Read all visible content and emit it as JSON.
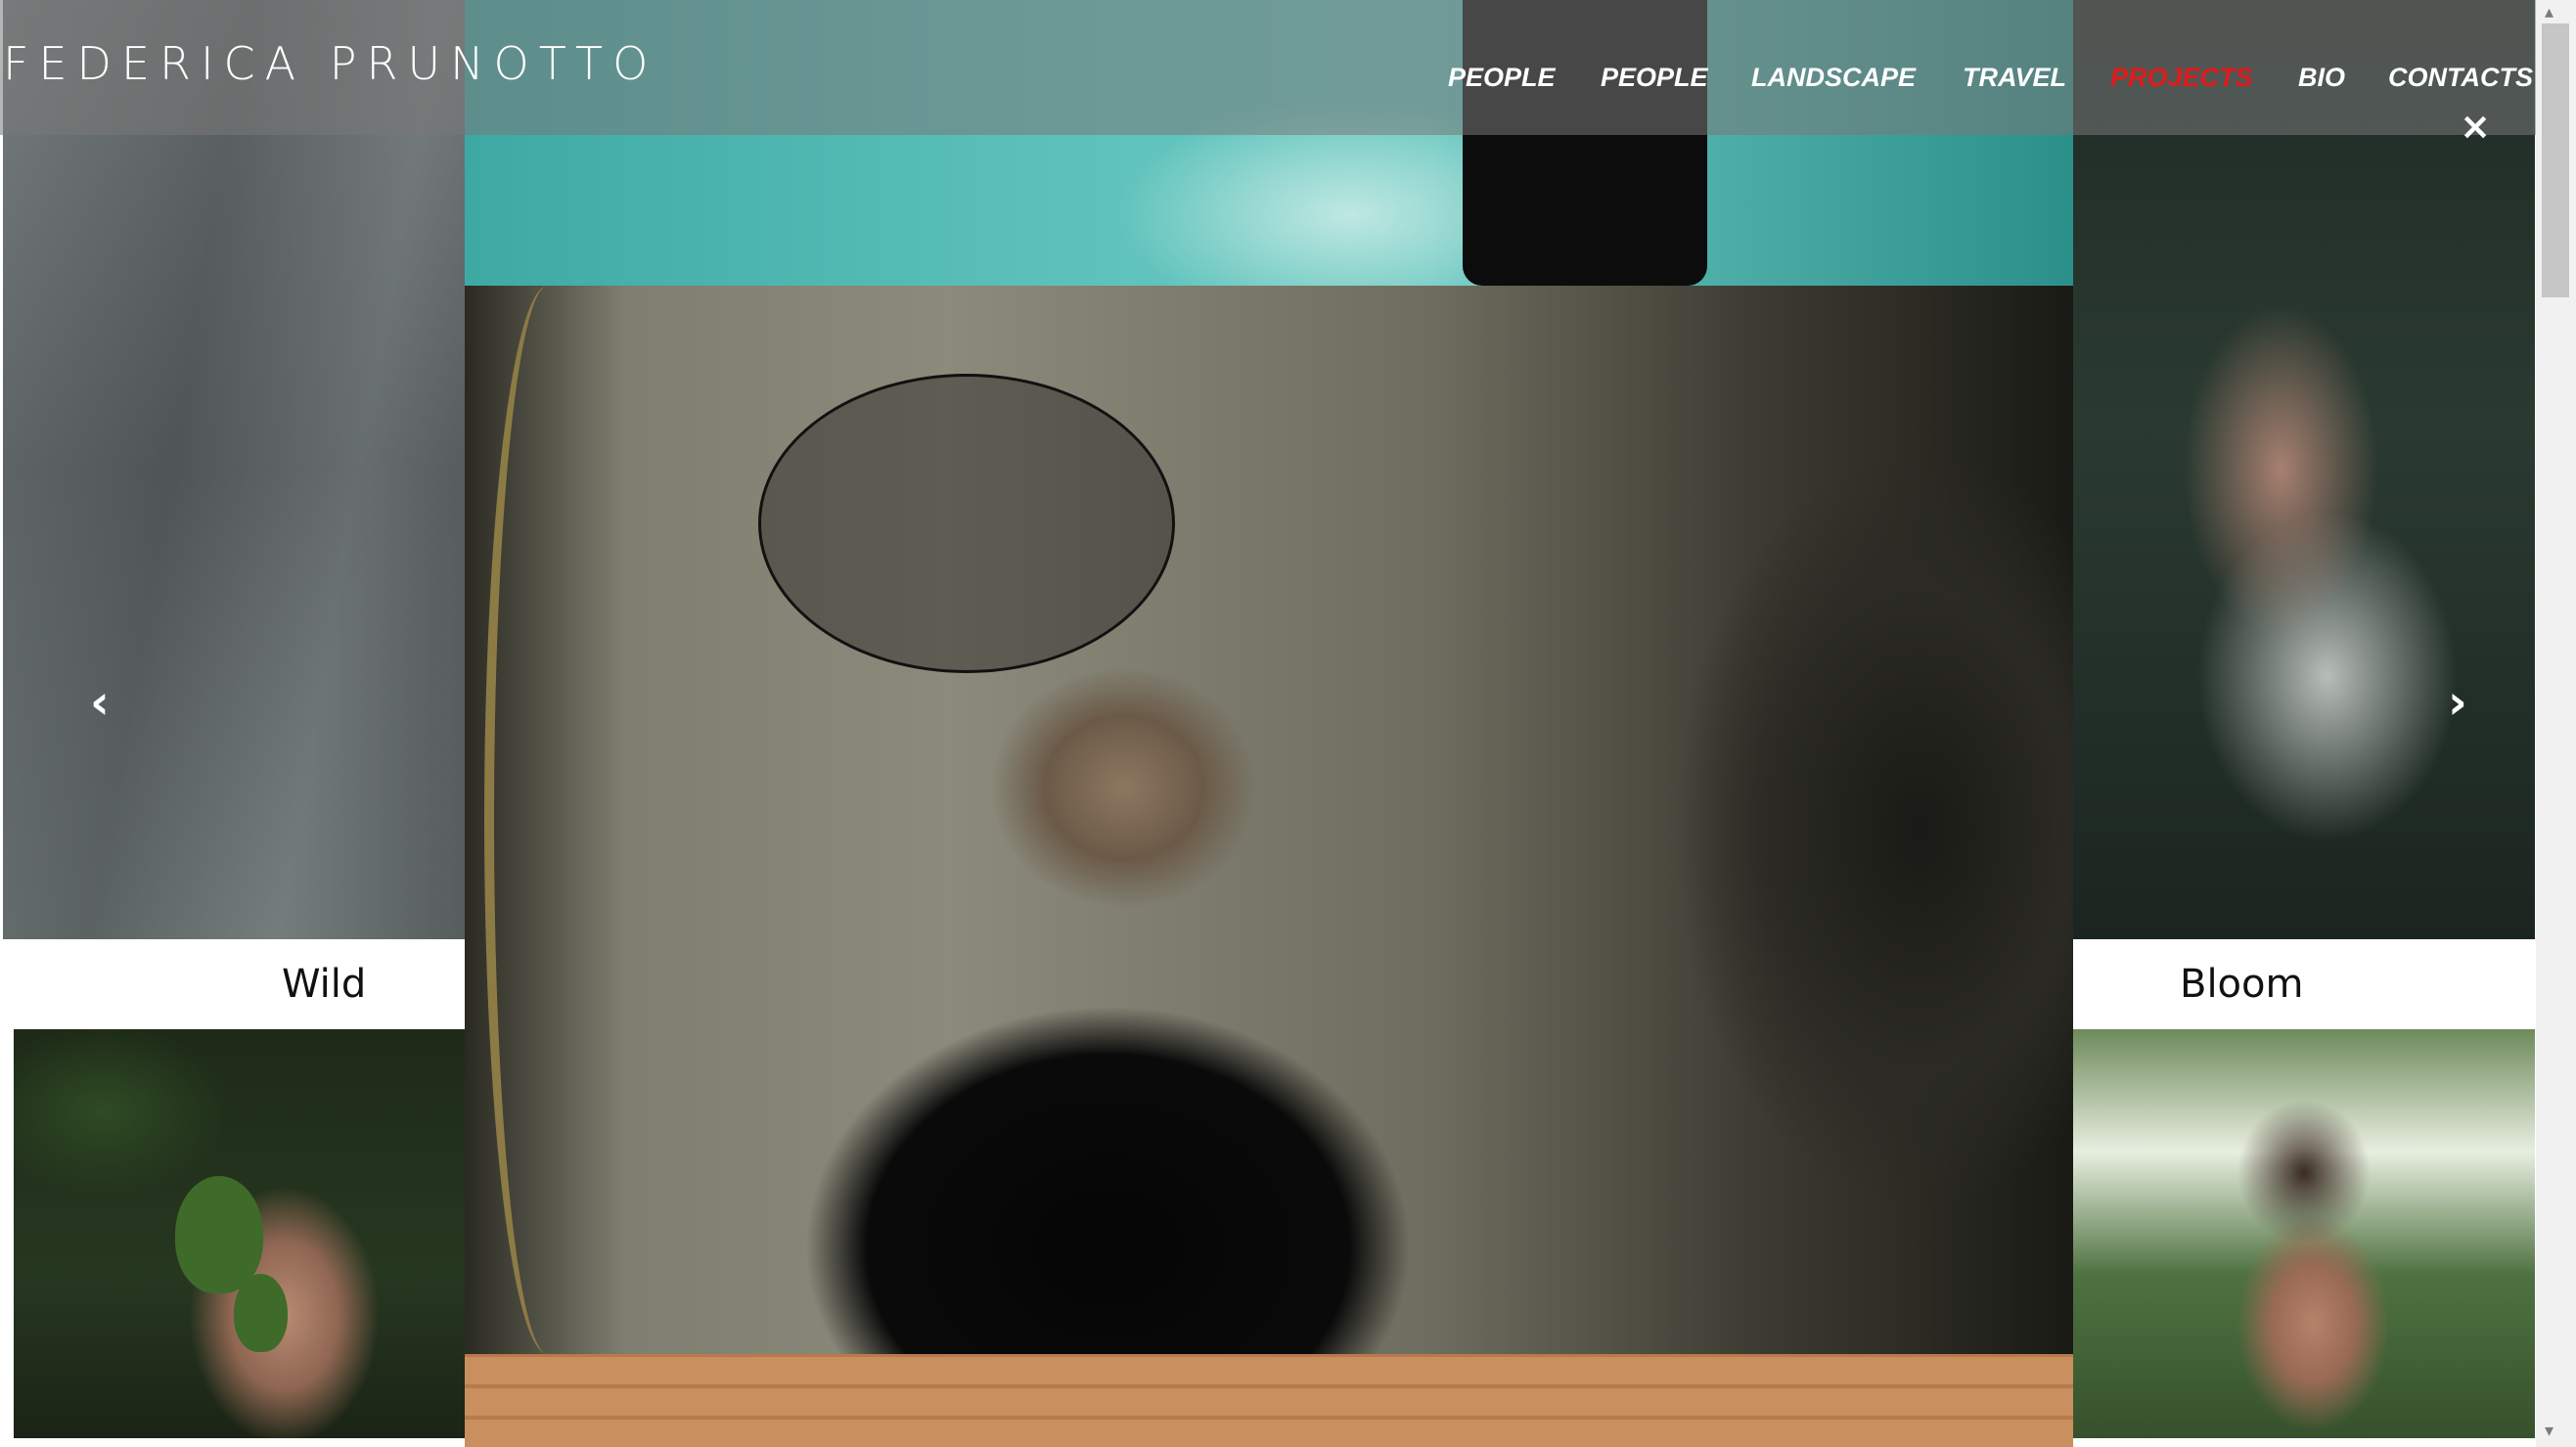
{
  "header": {
    "title": "FEDERICA PRUNOTTO",
    "nav": [
      {
        "label": "PEOPLE",
        "active": false
      },
      {
        "label": "PEOPLE",
        "active": false
      },
      {
        "label": "LANDSCAPE",
        "active": false
      },
      {
        "label": "TRAVEL",
        "active": false
      },
      {
        "label": "PROJECTS",
        "active": true
      },
      {
        "label": "BIO",
        "active": false
      },
      {
        "label": "CONTACTS",
        "active": false
      }
    ]
  },
  "lightbox": {
    "close_icon": "×",
    "prev_icon": "‹",
    "next_icon": "›"
  },
  "gallery": {
    "captions": [
      "Wild",
      "Bloom"
    ]
  },
  "colors": {
    "nav_text": "#ffffff",
    "nav_active": "#e01b1b",
    "header_overlay": "rgba(120,120,120,0.55)"
  }
}
